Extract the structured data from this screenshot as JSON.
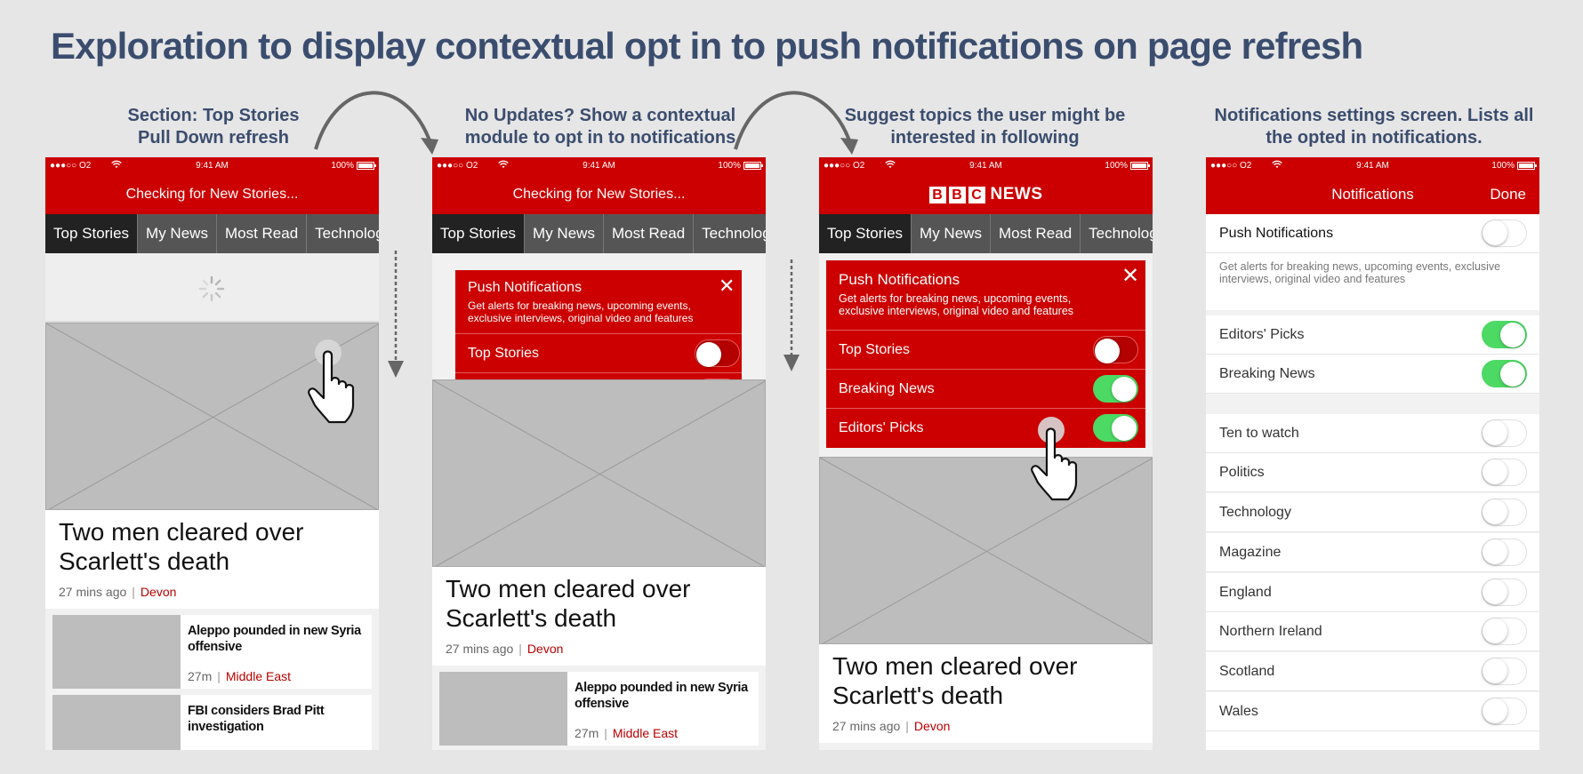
{
  "title": "Exploration to display contextual opt in to push notifications on page refresh",
  "colors": {
    "brand": "#cc0000",
    "title": "#3b4d6e",
    "toggle_on": "#4cd964",
    "link": "#b80000"
  },
  "captions": [
    {
      "line1": "Section: Top Stories",
      "line2": "Pull Down refresh"
    },
    {
      "line1": "No Updates? Show a contextual",
      "line2": "module to opt in to notifications"
    },
    {
      "line1": "Suggest topics the user might be",
      "line2": "interested in following"
    },
    {
      "line1": "Notifications settings screen. Lists all",
      "line2": "the opted in notifications."
    }
  ],
  "status": {
    "carrier": "●●●○○ O2",
    "time": "9:41 AM",
    "battery": "100%"
  },
  "header": {
    "checking": "Checking for New Stories...",
    "logo_letters": [
      "B",
      "B",
      "C"
    ],
    "logo_word": "NEWS"
  },
  "tabs": [
    "Top Stories",
    "My News",
    "Most Read",
    "Technology"
  ],
  "story": {
    "headline": "Two men cleared over Scarlett's death",
    "time": "27 mins ago",
    "separator": "|",
    "tag": "Devon"
  },
  "stories": [
    {
      "title": "Aleppo pounded in new Syria offensive",
      "time": "27m",
      "tag": "Middle East"
    },
    {
      "title": "FBI considers Brad Pitt investigation"
    }
  ],
  "module": {
    "title": "Push Notifications",
    "description": "Get alerts for breaking news, upcoming events, exclusive interviews, original video and features",
    "close": "✕",
    "rows": [
      {
        "label": "Top Stories",
        "on": false
      },
      {
        "label": "Breaking News",
        "on": true
      },
      {
        "label": "Editors' Picks",
        "on": true
      }
    ]
  },
  "settings": {
    "title": "Notifications",
    "done": "Done",
    "push": {
      "label": "Push Notifications",
      "on": false
    },
    "description": "Get alerts for breaking news, upcoming events, exclusive interviews, original video and features",
    "group1": [
      {
        "label": "Editors' Picks",
        "on": true
      },
      {
        "label": "Breaking News",
        "on": true
      }
    ],
    "group2": [
      {
        "label": "Ten to watch",
        "on": false
      },
      {
        "label": "Politics",
        "on": false
      },
      {
        "label": "Technology",
        "on": false
      },
      {
        "label": "Magazine",
        "on": false
      },
      {
        "label": "England",
        "on": false
      },
      {
        "label": "Northern Ireland",
        "on": false
      },
      {
        "label": "Scotland",
        "on": false
      },
      {
        "label": "Wales",
        "on": false
      }
    ]
  }
}
